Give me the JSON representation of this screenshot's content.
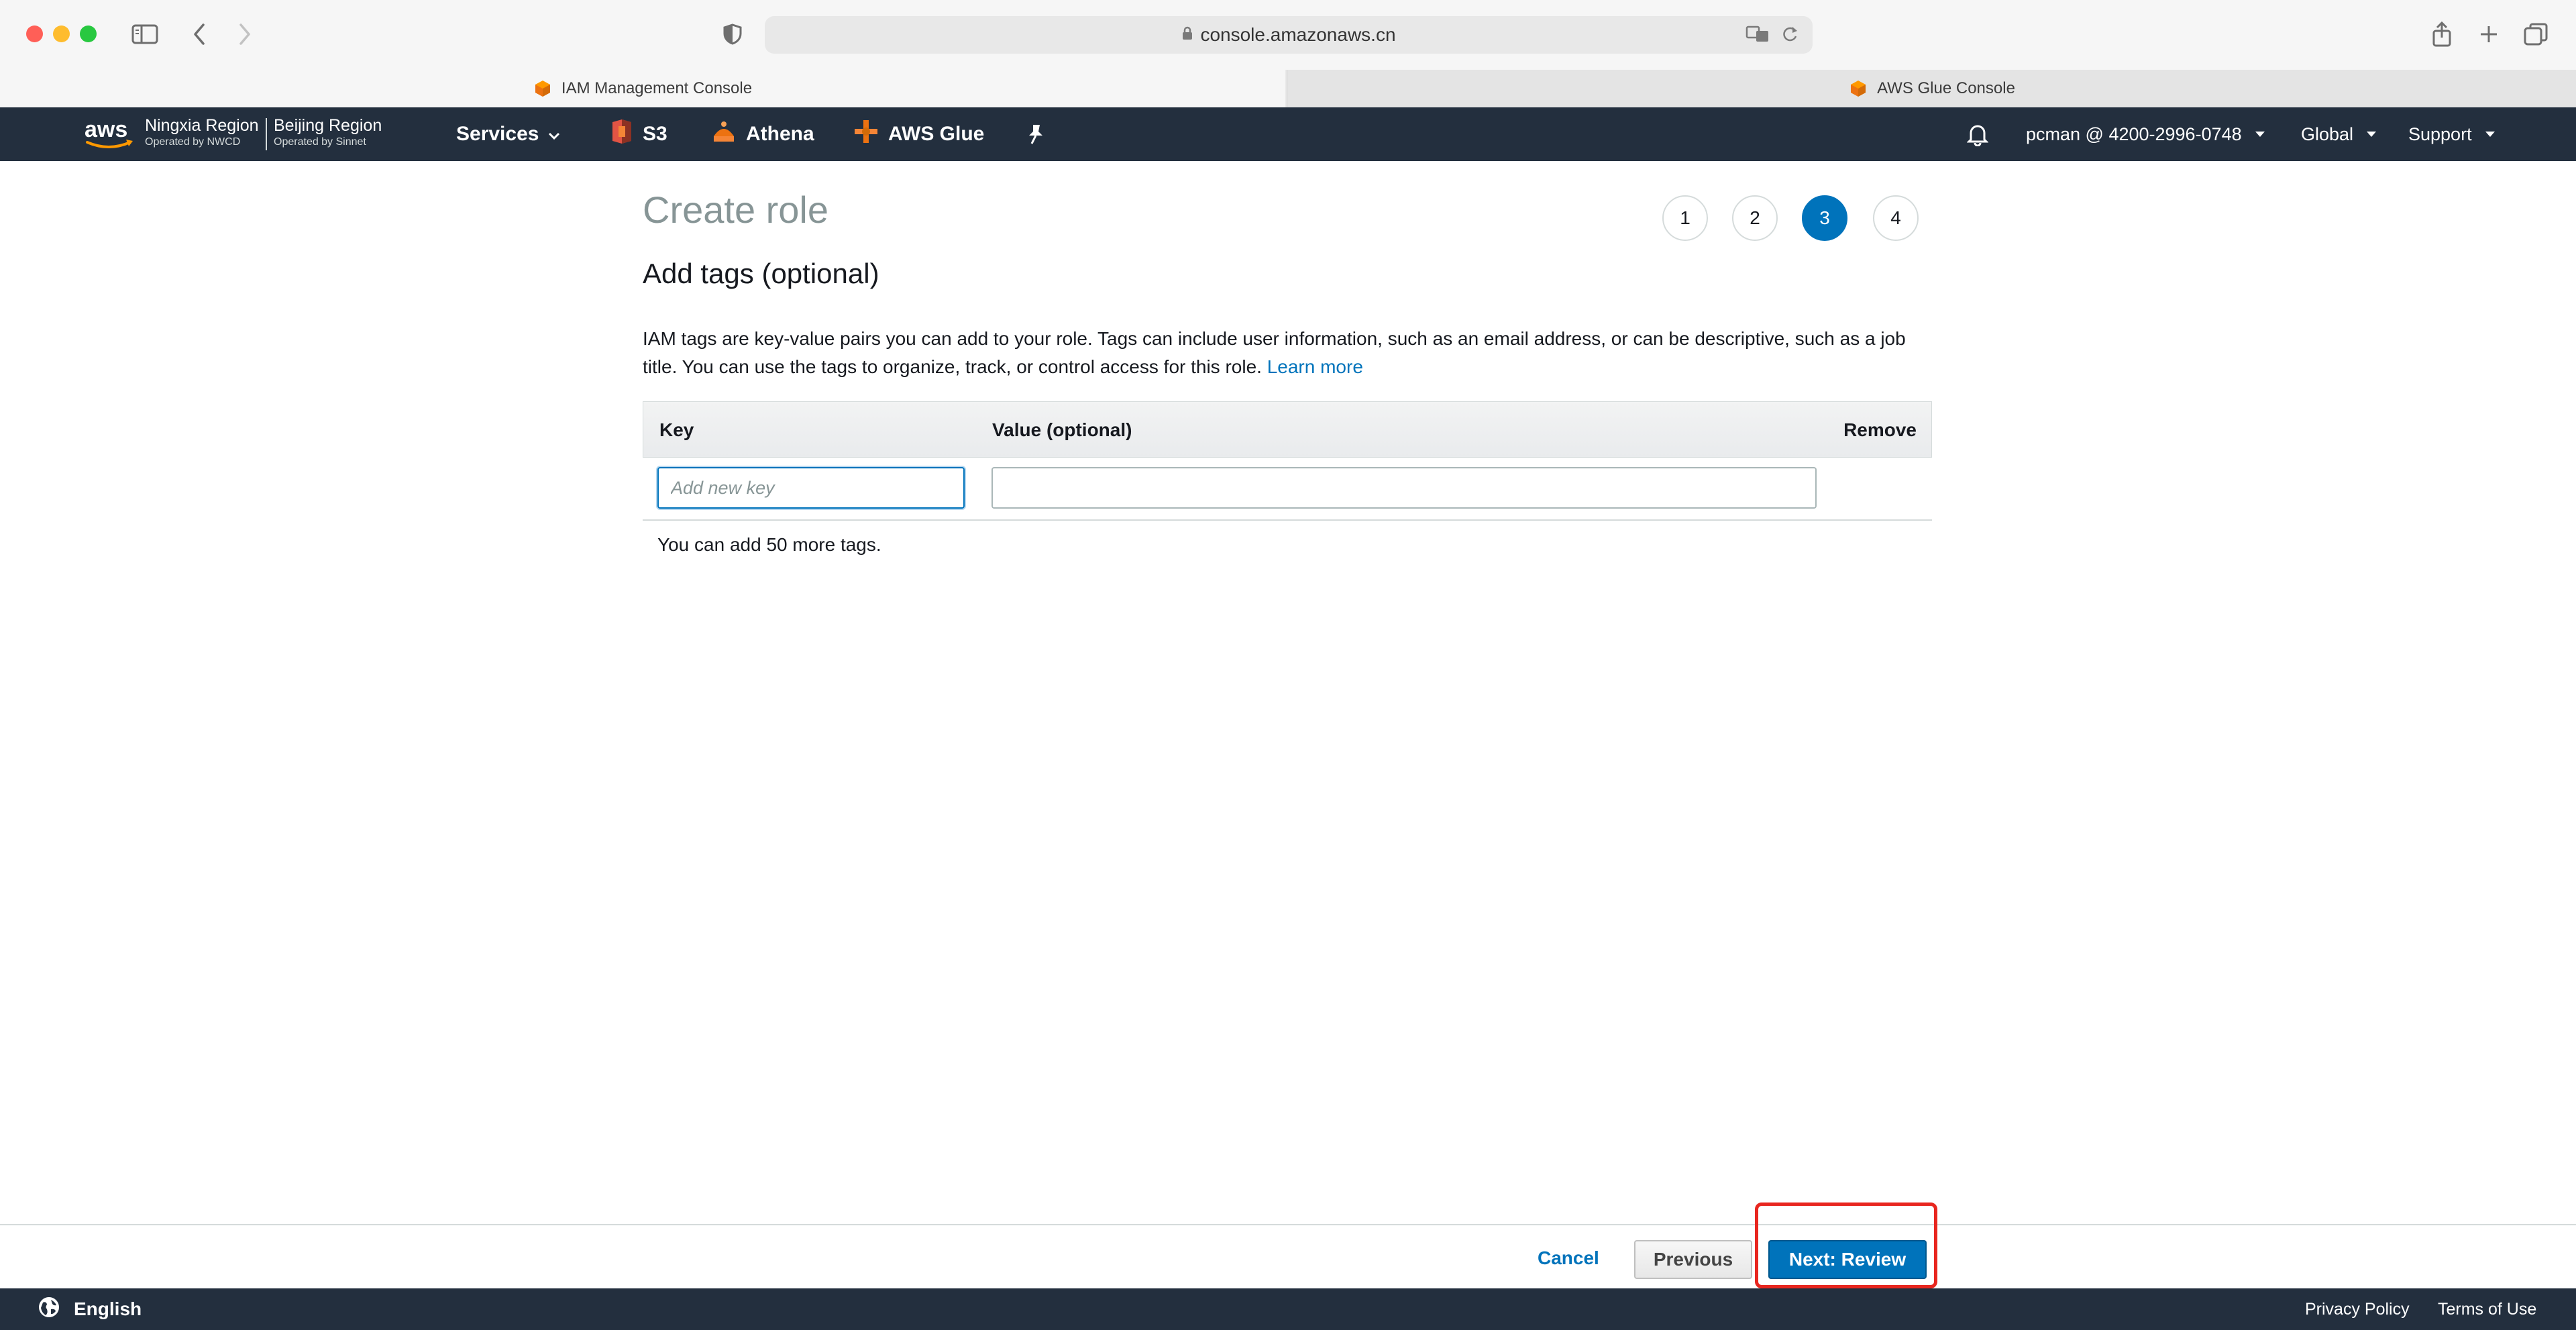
{
  "browser": {
    "url": "console.amazonaws.cn",
    "tabs": [
      {
        "label": "IAM Management Console",
        "active": true
      },
      {
        "label": "AWS Glue Console",
        "active": false
      }
    ]
  },
  "nav": {
    "logo_text": "aws",
    "region1": {
      "name": "Ningxia Region",
      "operator": "Operated by NWCD"
    },
    "region2": {
      "name": "Beijing Region",
      "operator": "Operated by Sinnet"
    },
    "services": "Services",
    "favorites": [
      "S3",
      "Athena",
      "AWS Glue"
    ],
    "account": "pcman @ 4200-2996-0748",
    "global": "Global",
    "support": "Support"
  },
  "page": {
    "title": "Create role",
    "steps": [
      "1",
      "2",
      "3",
      "4"
    ],
    "active_step": "3",
    "section_title": "Add tags (optional)",
    "description": "IAM tags are key-value pairs you can add to your role. Tags can include user information, such as an email address, or can be descriptive, such as a job title. You can use the tags to organize, track, or control access for this role.",
    "learn_more": "Learn more",
    "table": {
      "headers": {
        "key": "Key",
        "value": "Value (optional)",
        "remove": "Remove"
      },
      "key_placeholder": "Add new key",
      "key_value": "",
      "value_value": ""
    },
    "tags_left": "You can add 50 more tags."
  },
  "actions": {
    "cancel": "Cancel",
    "previous": "Previous",
    "next": "Next: Review"
  },
  "footer": {
    "language": "English",
    "privacy": "Privacy Policy",
    "terms": "Terms of Use"
  },
  "colors": {
    "aws_nav": "#232f3e",
    "primary": "#0073bb",
    "aws_orange": "#ff9900",
    "highlight": "#e8261f"
  }
}
